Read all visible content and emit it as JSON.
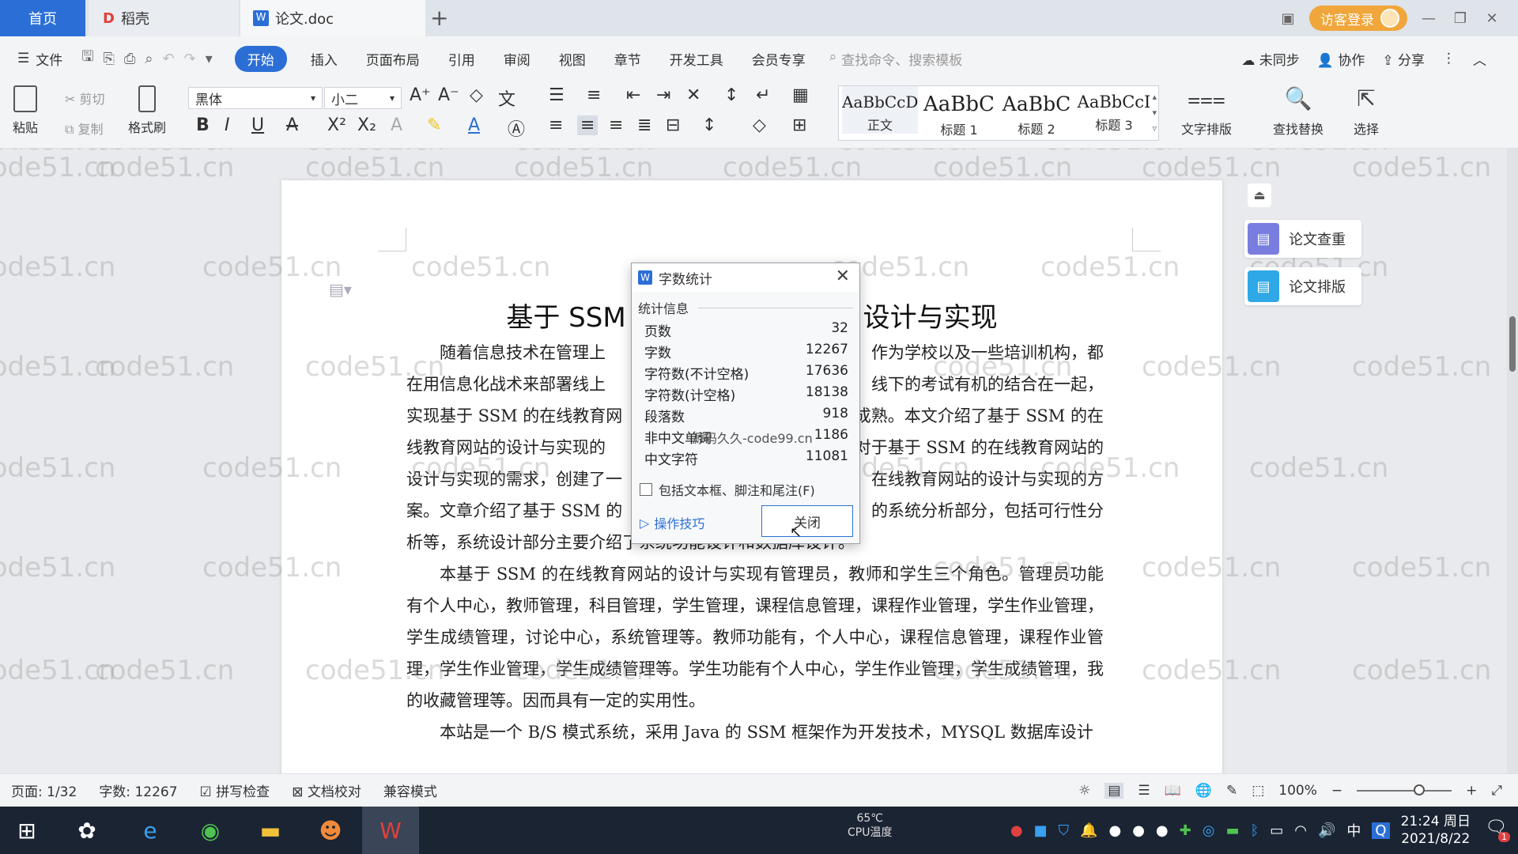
{
  "tabs": {
    "home": "首页",
    "daoke": "稻壳",
    "doc": "论文.doc"
  },
  "header": {
    "login_label": "访客登录"
  },
  "menu": {
    "file": "文件",
    "items": [
      "开始",
      "插入",
      "页面布局",
      "引用",
      "审阅",
      "视图",
      "章节",
      "开发工具",
      "会员专享"
    ],
    "search_placeholder": "查找命令、搜索模板",
    "sync": "未同步",
    "collab": "协作",
    "share": "分享"
  },
  "ribbon": {
    "paste": "粘贴",
    "cut": "剪切",
    "copy": "复制",
    "format_painter": "格式刷",
    "font_name": "黑体",
    "font_size": "小二",
    "styles": [
      {
        "sample": "AaBbCcDd",
        "label": "正文"
      },
      {
        "sample": "AaBbC",
        "label": "标题 1"
      },
      {
        "sample": "AaBbC",
        "label": "标题 2"
      },
      {
        "sample": "AaBbCcI",
        "label": "标题 3"
      }
    ],
    "text_layout": "文字排版",
    "find_replace": "查找替换",
    "select": "选择"
  },
  "document": {
    "title_left": "基于 SSM",
    "title_right": "设计与实现",
    "lines": [
      "随着信息技术在管理上",
      "作为学校以及一些培训机构，都",
      "在用信息化战术来部署线上",
      "线下的考试有机的结合在一起，",
      "实现基于 SSM 的在线教育网",
      "成熟。本文介绍了基于 SSM 的在",
      "线教育网站的设计与实现的",
      "对于基于 SSM 的在线教育网站的",
      "设计与实现的需求，创建了一",
      "在线教育网站的设计与实现的方",
      "案。文章介绍了基于 SSM 的",
      "的系统分析部分，包括可行性分",
      "析等，系统设计部分主要介绍了系统功能设计和数据库设计。"
    ],
    "para2": "本基于 SSM 的在线教育网站的设计与实现有管理员，教师和学生三个角色。管理员功能有个人中心，教师管理，科目管理，学生管理，课程信息管理，课程作业管理，学生作业管理，学生成绩管理，讨论中心，系统管理等。教师功能有，个人中心，课程信息管理，课程作业管理，学生作业管理，学生成绩管理等。学生功能有个人中心，学生作业管理，学生成绩管理，我的收藏管理等。因而具有一定的实用性。",
    "para3": "本站是一个 B/S 模式系统，采用 Java 的 SSM 框架作为开发技术，MYSQL 数据库设计",
    "watermark": "code51.cn"
  },
  "side_panel": {
    "check": "论文查重",
    "layout": "论文排版"
  },
  "dialog": {
    "title": "字数统计",
    "section": "统计信息",
    "stats": [
      {
        "label": "页数",
        "value": "32"
      },
      {
        "label": "字数",
        "value": "12267"
      },
      {
        "label": "字符数(不计空格)",
        "value": "17636"
      },
      {
        "label": "字符数(计空格)",
        "value": "18138"
      },
      {
        "label": "段落数",
        "value": "918"
      },
      {
        "label": "非中文单词",
        "value": "1186"
      },
      {
        "label": "中文字符",
        "value": "11081"
      }
    ],
    "overlay_text": "源码久久-code99.cn",
    "checkbox_label": "包括文本框、脚注和尾注(F)",
    "tips": "操作技巧",
    "close_button": "关闭"
  },
  "status": {
    "page": "页面: 1/32",
    "words": "字数: 12267",
    "spell": "拼写检查",
    "proof": "文档校对",
    "compat": "兼容模式",
    "zoom": "100%",
    "zoom_fraction": 0.66
  },
  "taskbar": {
    "cpu_temp": "65℃",
    "cpu_label": "CPU温度",
    "time": "21:24 周日",
    "date": "2021/8/22",
    "ime": "中",
    "notif_count": "1"
  },
  "colors": {
    "accent": "#2b6fd6",
    "login": "#f0a63a",
    "taskbar": "#1a2433"
  }
}
